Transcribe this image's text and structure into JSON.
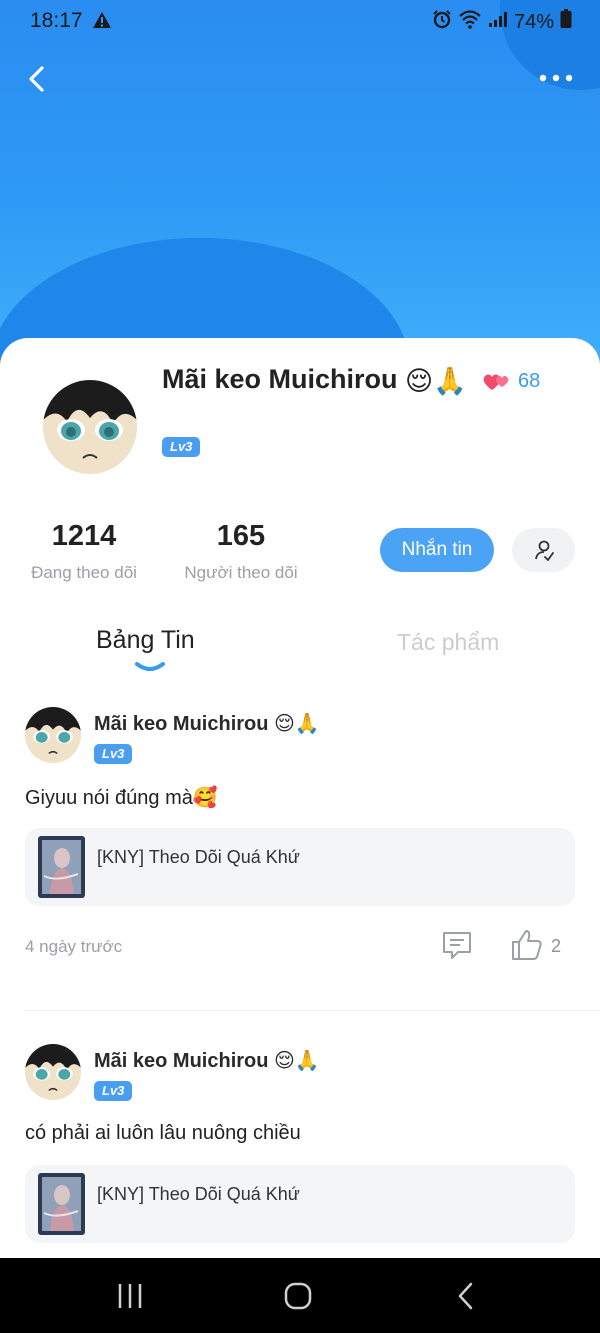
{
  "status_bar": {
    "time": "18:17",
    "battery_percent": "74%",
    "icons": [
      "warning-icon",
      "alarm-icon",
      "wifi-icon",
      "signal-icon",
      "battery-icon"
    ]
  },
  "header": {
    "back_icon": "chevron-left-icon",
    "more_icon": "more-dots-icon"
  },
  "profile": {
    "name": "Mãi keo Muichirou",
    "name_emojis": "😌🙏",
    "heart_count": "68",
    "level": "Lv3",
    "following_count": "1214",
    "following_label": "Đang theo dõi",
    "followers_count": "165",
    "followers_label": "Người theo dõi",
    "message_button": "Nhắn tin"
  },
  "tabs": {
    "news": "Bảng Tin",
    "works": "Tác phẩm",
    "active": "news"
  },
  "posts": [
    {
      "author": "Mãi keo Muichirou",
      "author_emojis": "😌🙏",
      "level": "Lv3",
      "text": "Giyuu nói đúng mà🥰",
      "attachment_title": "[KNY] Theo Dõi Quá Khứ",
      "time_ago": "4 ngày trước",
      "like_count": "2"
    },
    {
      "author": "Mãi keo Muichirou",
      "author_emojis": "😌🙏",
      "level": "Lv3",
      "text": "có phải ai luôn lâu nuông chiều",
      "attachment_title": "[KNY] Theo Dõi Quá Khứ"
    }
  ],
  "colors": {
    "brand_blue": "#2f9bf5",
    "accent": "#4aa3f5",
    "level_badge": "#4a9ef0",
    "heart_count": "#3a9af0"
  },
  "nav_bar": [
    "recent-apps-icon",
    "home-icon",
    "back-icon"
  ]
}
